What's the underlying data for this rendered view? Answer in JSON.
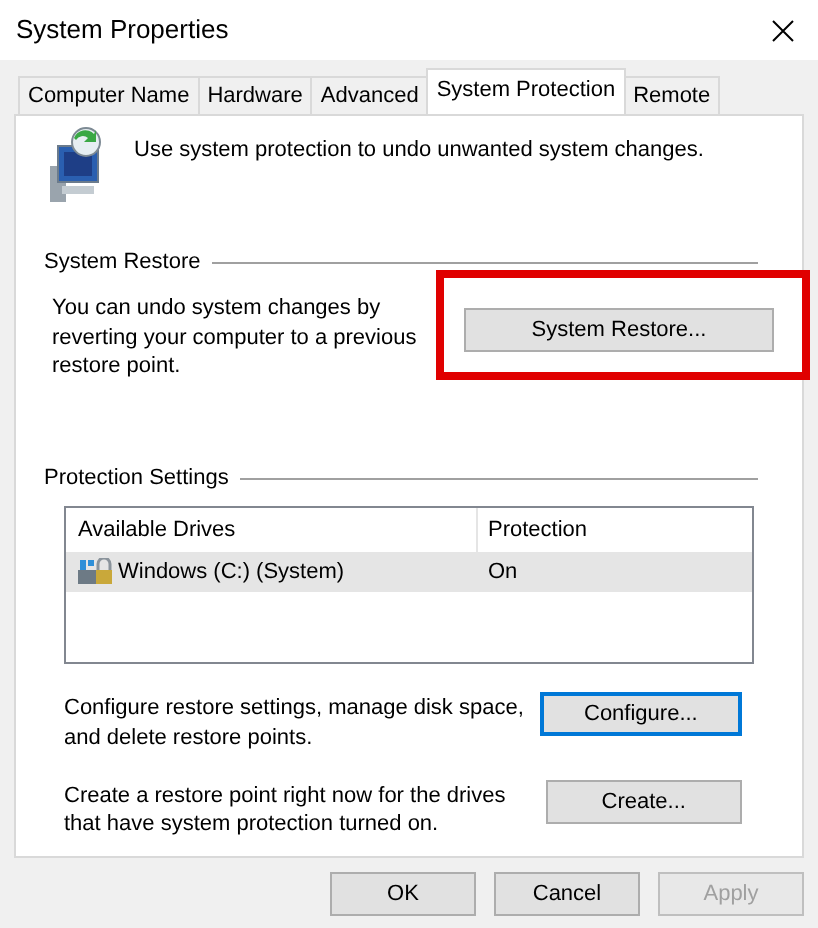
{
  "window": {
    "title": "System Properties"
  },
  "tabs": [
    {
      "label": "Computer Name",
      "selected": false
    },
    {
      "label": "Hardware",
      "selected": false
    },
    {
      "label": "Advanced",
      "selected": false
    },
    {
      "label": "System Protection",
      "selected": true
    },
    {
      "label": "Remote",
      "selected": false
    }
  ],
  "intro": "Use system protection to undo unwanted system changes.",
  "system_restore": {
    "heading": "System Restore",
    "description": "You can undo system changes by reverting your computer to a previous restore point.",
    "button": {
      "label": "System Restore...",
      "highlighted": true
    }
  },
  "protection_settings": {
    "heading": "Protection Settings",
    "columns": [
      "Available Drives",
      "Protection"
    ],
    "rows": [
      {
        "drive": "Windows (C:) (System)",
        "protection": "On",
        "selected": true
      }
    ],
    "configure": {
      "description": "Configure restore settings, manage disk space, and delete restore points.",
      "button": {
        "label": "Configure...",
        "default": true
      }
    },
    "create": {
      "description": "Create a restore point right now for the drives that have system protection turned on.",
      "button": {
        "label": "Create...",
        "default": false
      }
    }
  },
  "buttons": [
    {
      "label": "OK",
      "disabled": false
    },
    {
      "label": "Cancel",
      "disabled": false
    },
    {
      "label": "Apply",
      "disabled": true
    }
  ]
}
